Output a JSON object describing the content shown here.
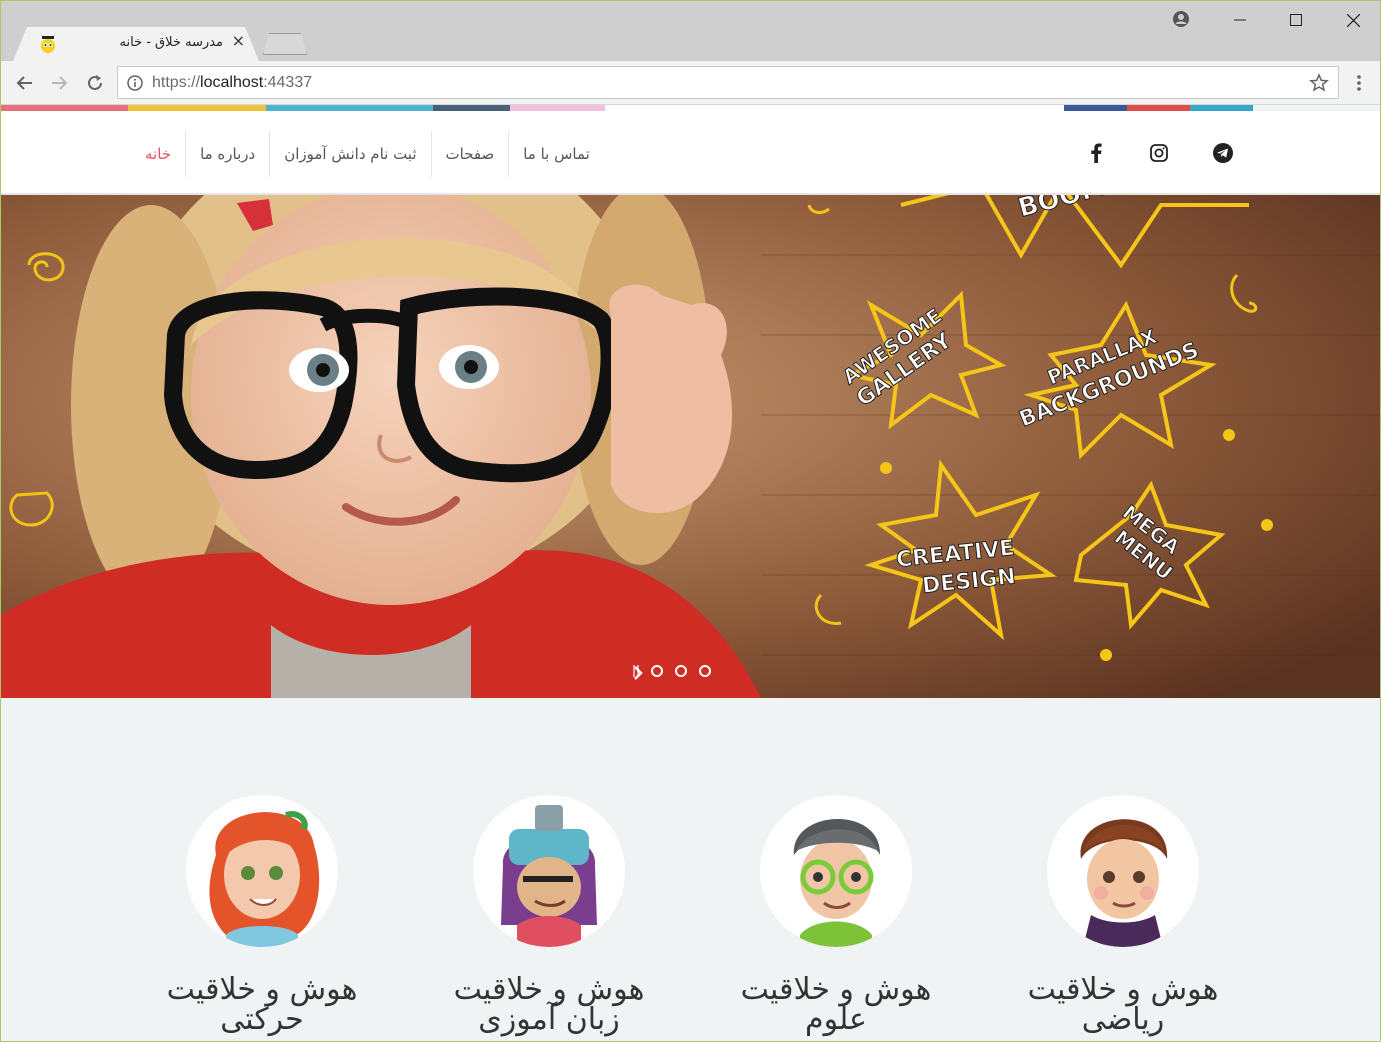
{
  "browser": {
    "tab_title": "مدرسه خلاق - خانه",
    "url_scheme": "https://",
    "url_host": "localhost",
    "url_port": ":44337"
  },
  "colors": {
    "accent_red": "#e8515f",
    "strip": [
      "#e8707a",
      "#f2c23a",
      "#4fb3cf",
      "#4a6079",
      "#f3c0dc",
      "#ffffff",
      "#3b5998",
      "#e04b4b",
      "#35a8c9"
    ]
  },
  "nav": {
    "items": [
      {
        "label": "خانه",
        "active": true
      },
      {
        "label": "درباره ما",
        "active": false
      },
      {
        "label": "ثبت نام دانش آموزان",
        "active": false
      },
      {
        "label": "صفحات",
        "active": false
      },
      {
        "label": "تماس با ما",
        "active": false
      }
    ],
    "social_icons": [
      "facebook-icon",
      "instagram-icon",
      "telegram-icon"
    ]
  },
  "hero": {
    "stickers": [
      "BOOM",
      "AWESOME GALLERY",
      "PARALLAX BACKGROUNDS",
      "CREATIVE DESIGN",
      "MEGA MENU"
    ],
    "slides": 3,
    "active_slide": 0
  },
  "features": [
    {
      "line1": "هوش و خلاقیت",
      "line2": "حرکتی"
    },
    {
      "line1": "هوش و خلاقیت",
      "line2": "زبان آموزی"
    },
    {
      "line1": "هوش و خلاقیت",
      "line2": "علوم"
    },
    {
      "line1": "هوش و خلاقیت",
      "line2": "ریاضی"
    }
  ]
}
